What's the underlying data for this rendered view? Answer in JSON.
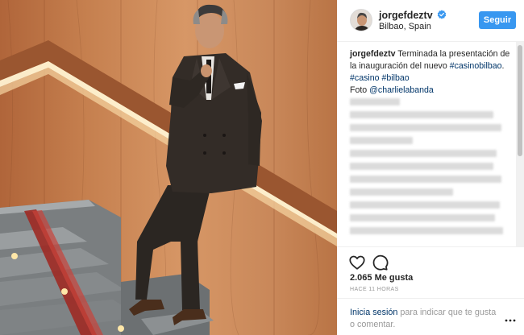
{
  "header": {
    "username": "jorgefdeztv",
    "location": "Bilbao, Spain",
    "follow_label": "Seguir"
  },
  "caption": {
    "username": "jorgefdeztv",
    "text": "Terminada la presentación de la inauguración del nuevo",
    "hashtag_1": "#casinobilbao",
    "after_hashtag_1": ".",
    "hashtag_2": "#casino",
    "hashtag_3": "#bilbao",
    "photo_credit_prefix": "Foto",
    "photo_credit_user": "@charlielabanda"
  },
  "stats": {
    "likes": "2.065 Me gusta",
    "timestamp": "HACE 11 HORAS"
  },
  "login_prompt": {
    "link": "Inicia sesión",
    "text": "para indicar que te gusta o comentar."
  },
  "icons": {
    "verified": "verified-badge-icon",
    "like": "heart-icon",
    "comment": "comment-bubble-icon",
    "more": "more-options-icon"
  },
  "colors": {
    "follow_button": "#3897f0",
    "link": "#003569",
    "verified": "#3897f0"
  }
}
